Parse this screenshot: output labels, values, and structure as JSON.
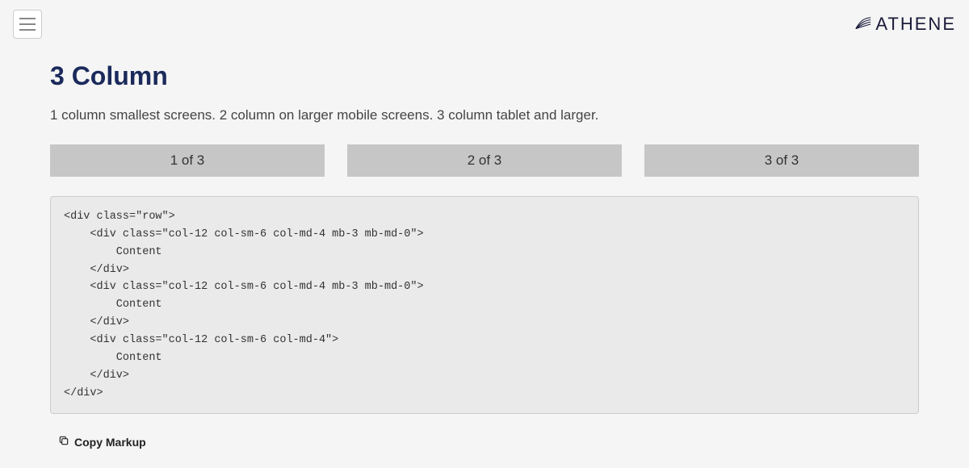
{
  "header": {
    "logo_text": "ATHENE"
  },
  "page": {
    "title": "3 Column",
    "subtitle": "1 column smallest screens. 2 column on larger mobile screens. 3 column tablet and larger."
  },
  "columns": {
    "c1": "1 of 3",
    "c2": "2 of 3",
    "c3": "3 of 3"
  },
  "code_markup": "<div class=\"row\">\n    <div class=\"col-12 col-sm-6 col-md-4 mb-3 mb-md-0\">\n        Content\n    </div>\n    <div class=\"col-12 col-sm-6 col-md-4 mb-3 mb-md-0\">\n        Content\n    </div>\n    <div class=\"col-12 col-sm-6 col-md-4\">\n        Content\n    </div>\n</div>",
  "actions": {
    "copy_label": "Copy Markup"
  }
}
